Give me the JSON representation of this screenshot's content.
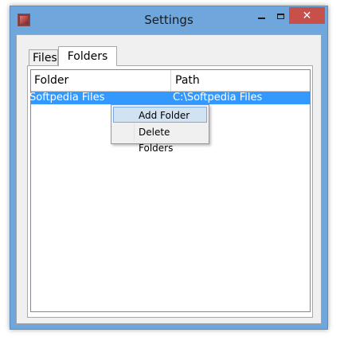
{
  "window": {
    "title": "Settings",
    "close_glyph": "✕",
    "icon": "app-icon"
  },
  "tabs": [
    {
      "label": "Files",
      "selected": false
    },
    {
      "label": "Folders",
      "selected": true
    }
  ],
  "table": {
    "columns": [
      "Folder",
      "Path"
    ],
    "rows": [
      {
        "folder": "Softpedia Files",
        "path": "C:\\Softpedia Files",
        "selected": true
      }
    ]
  },
  "context_menu": {
    "items": [
      "Add Folder",
      "Delete Folders"
    ],
    "highlighted": "Add Folder"
  },
  "colors": {
    "frame": "#6fa6dc",
    "close_button": "#c7504a",
    "selection": "#3399ff",
    "menu_highlight": "#d1e2f2"
  }
}
